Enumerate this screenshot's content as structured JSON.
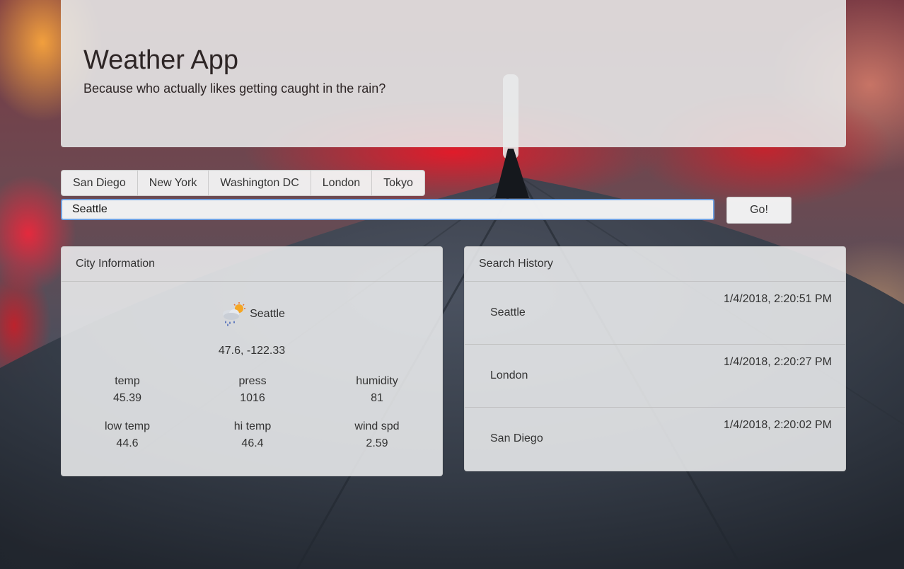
{
  "header": {
    "title": "Weather App",
    "subtitle": "Because who actually likes getting caught in the rain?"
  },
  "quick_cities": [
    "San Diego",
    "New York",
    "Washington DC",
    "London",
    "Tokyo"
  ],
  "search": {
    "value": "Seattle",
    "go_label": "Go!"
  },
  "city_info": {
    "heading": "City Information",
    "city": "Seattle",
    "icon": "rain-cloud-sun-icon",
    "coords": "47.6, -122.33",
    "stats": [
      {
        "label": "temp",
        "value": "45.39"
      },
      {
        "label": "press",
        "value": "1016"
      },
      {
        "label": "humidity",
        "value": "81"
      },
      {
        "label": "low temp",
        "value": "44.6"
      },
      {
        "label": "hi temp",
        "value": "46.4"
      },
      {
        "label": "wind spd",
        "value": "2.59"
      }
    ]
  },
  "history": {
    "heading": "Search History",
    "items": [
      {
        "city": "Seattle",
        "time": "1/4/2018, 2:20:51 PM"
      },
      {
        "city": "London",
        "time": "1/4/2018, 2:20:27 PM"
      },
      {
        "city": "San Diego",
        "time": "1/4/2018, 2:20:02 PM"
      }
    ]
  },
  "colors": {
    "input_focus": "#6fa0e0",
    "text": "#333333",
    "title": "#2d2525"
  }
}
